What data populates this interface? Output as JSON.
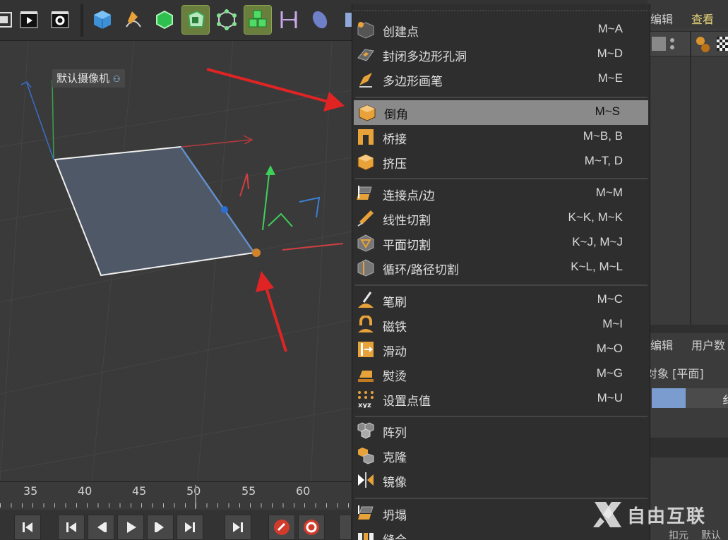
{
  "right_panel": {
    "tab_edit": "编辑",
    "tab_view": "查看",
    "tab_edit2": "编辑",
    "tab_userdata": "用户数",
    "object_label": "对象 [平面]",
    "slider_partial": "纟",
    "bottom_text1": "扣元",
    "bottom_text2": "默认"
  },
  "viewport": {
    "camera_label": "默认摄像机"
  },
  "timeline": {
    "ticks": [
      "35",
      "40",
      "45",
      "50",
      "55",
      "60"
    ]
  },
  "menu": {
    "items": [
      {
        "label": "创建点",
        "shortcut": "M~A",
        "icon": "create-point-icon"
      },
      {
        "label": "封闭多边形孔洞",
        "shortcut": "M~D",
        "icon": "close-polygon-hole-icon"
      },
      {
        "label": "多边形画笔",
        "shortcut": "M~E",
        "icon": "polygon-pen-icon"
      },
      {
        "label": "倒角",
        "shortcut": "M~S",
        "icon": "bevel-icon",
        "highlighted": true
      },
      {
        "label": "桥接",
        "shortcut": "M~B, B",
        "icon": "bridge-icon"
      },
      {
        "label": "挤压",
        "shortcut": "M~T, D",
        "icon": "extrude-icon"
      },
      {
        "label": "连接点/边",
        "shortcut": "M~M",
        "icon": "connect-points-edges-icon"
      },
      {
        "label": "线性切割",
        "shortcut": "K~K, M~K",
        "icon": "line-cut-icon"
      },
      {
        "label": "平面切割",
        "shortcut": "K~J, M~J",
        "icon": "plane-cut-icon"
      },
      {
        "label": "循环/路径切割",
        "shortcut": "K~L, M~L",
        "icon": "loop-path-cut-icon"
      },
      {
        "label": "笔刷",
        "shortcut": "M~C",
        "icon": "brush-icon"
      },
      {
        "label": "磁铁",
        "shortcut": "M~I",
        "icon": "magnet-icon"
      },
      {
        "label": "滑动",
        "shortcut": "M~O",
        "icon": "slide-icon"
      },
      {
        "label": "熨烫",
        "shortcut": "M~G",
        "icon": "iron-icon"
      },
      {
        "label": "设置点值",
        "shortcut": "M~U",
        "icon": "set-point-value-icon",
        "icon_text": "xyz"
      },
      {
        "label": "阵列",
        "shortcut": "",
        "icon": "array-icon"
      },
      {
        "label": "克隆",
        "shortcut": "",
        "icon": "clone-icon"
      },
      {
        "label": "镜像",
        "shortcut": "",
        "icon": "mirror-icon"
      },
      {
        "label": "坍塌",
        "shortcut": "",
        "icon": "collapse-icon"
      },
      {
        "label": "缝合",
        "shortcut": "",
        "icon": "stitch-icon"
      }
    ]
  },
  "watermark": {
    "text": "自由互联"
  },
  "colors": {
    "menu_bg": "#2e2e2e",
    "menu_highlight": "#8a8a8a",
    "viewport_bg": "#3a3a3a",
    "annotation_arrow": "#e02424",
    "active_tool": "#6a7e3e",
    "icon_orange": "#e8a23a"
  }
}
